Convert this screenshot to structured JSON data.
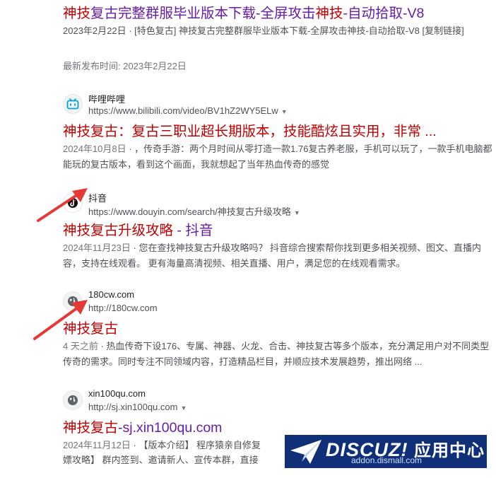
{
  "results": [
    {
      "title_hl1": "神技",
      "title_mid1": "复古完整群服毕业版本下载-全屏攻击",
      "title_hl2": "神技",
      "title_end": "-自动拾取-V8",
      "snippet": "2023年2月22日 · [特色复古] 神技复古完整群服毕业版本下载-全屏攻击神技-自动拾取-V8 [复制链接]",
      "latest_label": "最新发布时间: 2023年2月22日"
    },
    {
      "site_name": "哔哩哔哩",
      "site_url": "https://www.bilibili.com/video/BV1hZ2WY5ELw",
      "title_hl": "神技复古：复古三职业超长期版本，技能酷炫且实用，非常 ...",
      "snippet_date": "2024年10月8日",
      "snippet": " · ，传奇手游：两个月时间从零打造一款1.76复古养老服，手机可以玩了，一款手机电脑都能玩的复古版本，看到这个画面，我就想起了当年热血传奇的感觉"
    },
    {
      "site_name": "抖音",
      "site_url": "https://www.douyin.com/search/神技复古升级攻略",
      "title_hl": "神技复古升级攻略",
      "title_rest": " - 抖音",
      "snippet_date": "2024年11月23日",
      "snippet": " · 您在查找神技复古升级攻略吗？ 抖音综合搜索帮你找到更多相关视频、图文、直播内容，支持在线观看。 更有海量高清视频、相关直播、用户，满足您的在线观看需求。"
    },
    {
      "site_name": "180cw.com",
      "site_url": "http://180cw.com",
      "title_hl": "神技复古",
      "snippet_date": "4 天之前",
      "snippet": " · 热血传奇下设176、专属、神器、火龙、合击、神技复古等多个版本，充分满足用户对不同类型传奇的需求。同时专注不同领域内容，打造精品栏目，并顺应技术发展趋势，推出网络 ..."
    },
    {
      "site_name": "xin100qu.com",
      "site_url": "http://sj.xin100qu.com",
      "title_hl": "神技复古",
      "title_rest": "-sj.xin100qu.com",
      "snippet_date": "2024年11月12日",
      "snippet": " · 【版本介绍】 程序猿亲自修复",
      "snippet_line2": "嫖攻略】 群内签到、邀请新人、宣传本群，直接"
    }
  ],
  "watermark": {
    "brand": "DISCUZ!",
    "brand_cn": "应用中心",
    "sub": "addon.dismall.com"
  },
  "colors": {
    "title_visited": "#681da8",
    "title_highlight": "#c00000",
    "annotation_arrow": "#e53935",
    "bilibili": "#00a1d6",
    "watermark_bg": "#0f2f78"
  }
}
